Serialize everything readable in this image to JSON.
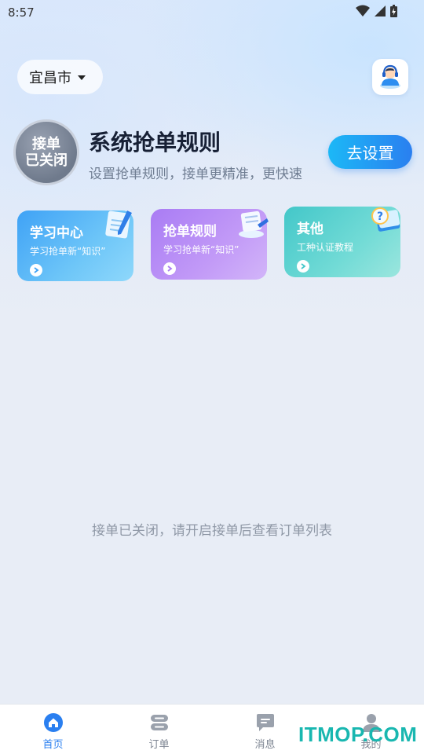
{
  "status": {
    "time": "8:57"
  },
  "city": {
    "label": "宜昌市"
  },
  "accept": {
    "line1": "接单",
    "line2": "已关闭"
  },
  "rules": {
    "title": "系统抢单规则",
    "subtitle": "设置抢单规则，接单更精准，更快速",
    "button": "去设置"
  },
  "cards": [
    {
      "title": "学习中心",
      "subtitle": "学习抢单新“知识”"
    },
    {
      "title": "抢单规则",
      "subtitle": "学习抢单新“知识”"
    },
    {
      "title": "其他",
      "subtitle": "工种认证教程"
    }
  ],
  "empty_message": "接单已关闭，请开启接单后查看订单列表",
  "nav": [
    {
      "label": "首页",
      "icon": "home-icon"
    },
    {
      "label": "订单",
      "icon": "order-icon"
    },
    {
      "label": "消息",
      "icon": "message-icon"
    },
    {
      "label": "我的",
      "icon": "profile-icon"
    }
  ],
  "watermark": "ITMOP.COM",
  "colors": {
    "accent": "#2a7ff0",
    "card1": "#3fa2f6",
    "card2": "#a97cf4",
    "card3": "#43c7c9"
  }
}
